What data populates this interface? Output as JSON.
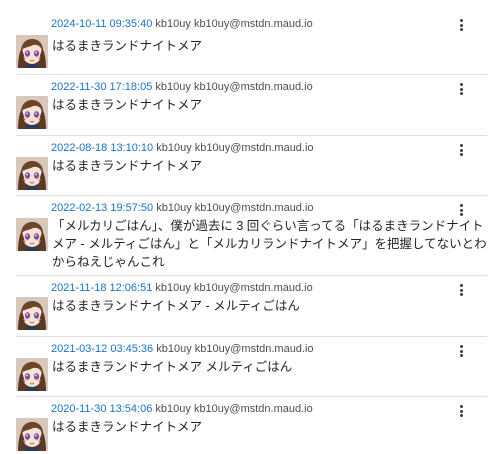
{
  "posts": [
    {
      "timestamp": "2024-10-11 09:35:40",
      "display_name": "kb10uy",
      "handle": "kb10uy@mstdn.maud.io",
      "text": "はるまきランドナイトメア"
    },
    {
      "timestamp": "2022-11-30 17:18:05",
      "display_name": "kb10uy",
      "handle": "kb10uy@mstdn.maud.io",
      "text": "はるまきランドナイトメア"
    },
    {
      "timestamp": "2022-08-18 13:10:10",
      "display_name": "kb10uy",
      "handle": "kb10uy@mstdn.maud.io",
      "text": "はるまきランドナイトメア"
    },
    {
      "timestamp": "2022-02-13 19:57:50",
      "display_name": "kb10uy",
      "handle": "kb10uy@mstdn.maud.io",
      "text": "「メルカリごはん」、僕が過去に 3 回ぐらい言ってる「はるまきランドナイトメア - メルティごはん」と「メルカリランドナイトメア」を把握してないとわからねえじゃんこれ"
    },
    {
      "timestamp": "2021-11-18 12:06:51",
      "display_name": "kb10uy",
      "handle": "kb10uy@mstdn.maud.io",
      "text": "はるまきランドナイトメア - メルティごはん"
    },
    {
      "timestamp": "2021-03-12 03:45:36",
      "display_name": "kb10uy",
      "handle": "kb10uy@mstdn.maud.io",
      "text": "はるまきランドナイトメア メルティごはん"
    },
    {
      "timestamp": "2020-11-30 13:54:06",
      "display_name": "kb10uy",
      "handle": "kb10uy@mstdn.maud.io",
      "text": "はるまきランドナイトメア"
    }
  ],
  "icons": {
    "avatar": "anime-girl-avatar",
    "menu": "more-vertical-icon"
  },
  "colors": {
    "link": "#1a73c8",
    "text": "#1f2328",
    "meta": "#4a4f55",
    "divider": "#dcdfe3"
  }
}
